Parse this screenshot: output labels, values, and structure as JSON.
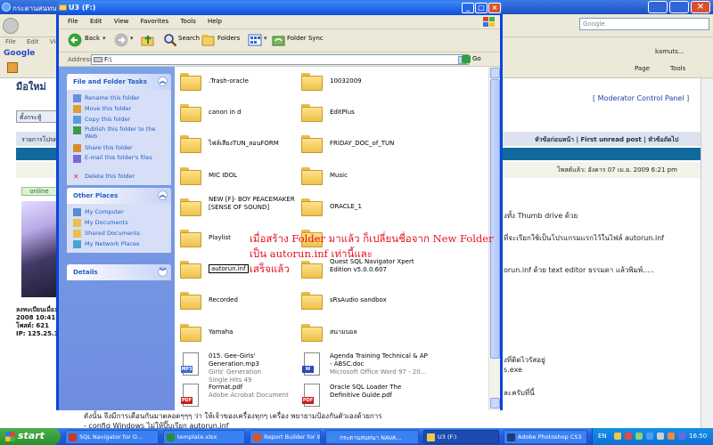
{
  "background_window": {
    "title": "กระดานสนทนา",
    "search_placeholder": "Google",
    "menu": [
      "File",
      "Edit",
      "View"
    ],
    "google_label": "Google",
    "account": "kamuts...",
    "page_menu": "Page",
    "tools_menu": "Tools",
    "heading": "มือใหม่",
    "moderator_panel": "[ Moderator Control Panel ]",
    "reply_button": "ตั้งกระทู้",
    "thread_bar": "รายการโปรด",
    "nav_links": "หัวข้อก่อนหน้า | First unread post | หัวข้อถัดไป",
    "posted": "โพสต์แล้ว: อังคาร 07 เม.ย. 2009 6:21 pm",
    "online_badge": "online",
    "user_info": [
      "ลงทะเบียนเมื่อ:",
      "2008 10:41",
      "โพสต์: 621",
      "IP: 125.25.1"
    ],
    "body_lines": [
      "งทั้ง Thumb drive ด้วย",
      "ที่จะเรียกใช้เป็นโปรแกรมแรกไว้ในไฟล์ autorun.inf",
      "orun.inf ด้วย text editor ธรรมดา แล้วพิมพ์.....",
      "งที่ติดไวรัสอยู่",
      "s.exe",
      "ละครับที่นี้",
      "ดังนั้น จึงมีการเดือนกันมาตลอดๆๆๆ ว่า ให้เจ้าของเครื่องทุกๆ เครื่อง พยายามป้องกันตัวเองด้วยการ",
      "- config Windows ไม่ให้ปิ๊บเรียก autorun.inf"
    ]
  },
  "explorer": {
    "title": "U3 (F:)",
    "menu": [
      "File",
      "Edit",
      "View",
      "Favorites",
      "Tools",
      "Help"
    ],
    "toolbar": {
      "back": "Back",
      "search": "Search",
      "folders": "Folders",
      "folder_sync": "Folder Sync"
    },
    "address_label": "Address",
    "address_value": "F:\\",
    "go": "Go",
    "file_tasks": {
      "title": "File and Folder Tasks",
      "items": [
        {
          "label": "Rename this folder",
          "icon": "rename-icon"
        },
        {
          "label": "Move this folder",
          "icon": "move-icon"
        },
        {
          "label": "Copy this folder",
          "icon": "copy-icon"
        },
        {
          "label": "Publish this folder to the Web",
          "icon": "publish-icon"
        },
        {
          "label": "Share this folder",
          "icon": "share-icon"
        },
        {
          "label": "E-mail this folder's files",
          "icon": "email-icon"
        },
        {
          "label": "Delete this folder",
          "icon": "delete-icon"
        }
      ]
    },
    "other_places": {
      "title": "Other Places",
      "items": [
        {
          "label": "My Computer",
          "icon": "computer-icon"
        },
        {
          "label": "My Documents",
          "icon": "documents-icon"
        },
        {
          "label": "Shared Documents",
          "icon": "shared-documents-icon"
        },
        {
          "label": "My Network Places",
          "icon": "network-icon"
        }
      ]
    },
    "details": {
      "title": "Details"
    },
    "items": [
      {
        "name": ".Trash-oracle",
        "type": "folder"
      },
      {
        "name": "10032009",
        "type": "folder"
      },
      {
        "name": "canon in d",
        "type": "folder"
      },
      {
        "name": "EditPlus",
        "type": "folder"
      },
      {
        "name": "ไฟล์เสียงTUN_สอนFORM",
        "type": "folder"
      },
      {
        "name": "FRIDAY_DOC_of_TUN",
        "type": "folder"
      },
      {
        "name": "MIC IDOL",
        "type": "folder"
      },
      {
        "name": "Music",
        "type": "folder"
      },
      {
        "name": "NEW [F]- BOY PEACEMAKER [SENSE OF SOUND]",
        "type": "folder"
      },
      {
        "name": "ORACLE_1",
        "type": "folder"
      },
      {
        "name": "Playlist",
        "type": "folder"
      },
      {
        "name": "",
        "type": "folder"
      },
      {
        "name": "autorun.inf",
        "type": "folder",
        "renaming": true
      },
      {
        "name": "Quest SQL Navigator Xpert Edition v5.0.0.607",
        "type": "folder"
      },
      {
        "name": "Recorded",
        "type": "folder"
      },
      {
        "name": "sRsAudio sandbox",
        "type": "folder"
      },
      {
        "name": "Yamaha",
        "type": "folder"
      },
      {
        "name": "สนามบอล",
        "type": "folder"
      },
      {
        "name": "015. Gee-Girls' Generation.mp3",
        "sub1": "Girls' Generation",
        "sub2": "Single Hits 49",
        "type": "mp3"
      },
      {
        "name": "Agenda Training Technical & AP - ABSC.doc",
        "sub1": "Microsoft Office Word 97 - 20...",
        "type": "doc"
      },
      {
        "name": "Format.pdf",
        "sub1": "Adobe Acrobat Document",
        "type": "pdf"
      },
      {
        "name": "Oracle SQL Loader The Definitive Guide.pdf",
        "type": "pdf"
      }
    ]
  },
  "annotation": {
    "line1": "เมื่อสร้าง Folder มาแล้ว ก็เปลี่ยนชื่อจาก New Folder",
    "line2": "เป็น autorun.inf เท่านี้และ",
    "line3": "เสร็จแล้ว"
  },
  "taskbar": {
    "start": "start",
    "buttons": [
      {
        "label": "SQL Navigator for O...",
        "color": "#c33b2b"
      },
      {
        "label": "template.xlsx",
        "color": "#2a8a3e"
      },
      {
        "label": "Report Builder for Wi...",
        "color": "#d4572a"
      },
      {
        "label": "กระดานสนทนา NAVA...",
        "color": "#3a8ae8"
      },
      {
        "label": "U3 (F:)",
        "color": "#f0c84a"
      },
      {
        "label": "Adobe Photoshop CS3",
        "color": "#1d3b7a"
      }
    ],
    "lang": "EN",
    "clock": "16:50"
  },
  "colors": {
    "xp_blue": "#0a46d8",
    "task_link": "#215dc6",
    "annotation_red": "#e8101e",
    "start_green": "#2e8d30"
  }
}
